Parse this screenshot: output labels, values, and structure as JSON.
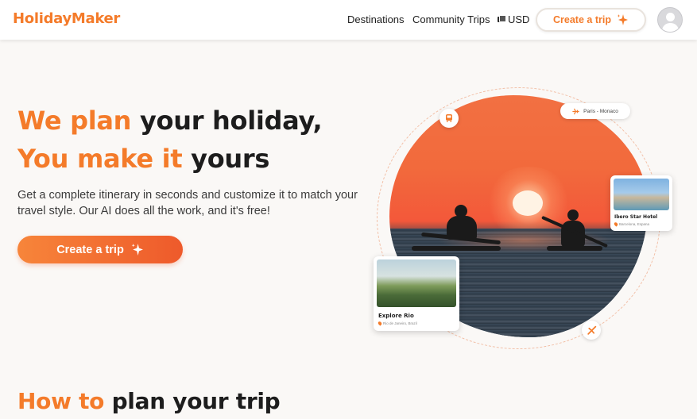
{
  "header": {
    "logo": "HolidayMaker",
    "nav": [
      {
        "label": "Destinations"
      },
      {
        "label": "Community Trips"
      }
    ],
    "currency": "USD",
    "cta_label": "Create a trip"
  },
  "hero": {
    "line1_accent": "We plan",
    "line1_rest": "your holiday,",
    "line2_accent": "You make it",
    "line2_rest": "yours",
    "description": "Get a complete itinerary in seconds and customize it to match your travel style. Our AI does all the work, and it's free!",
    "cta_label": "Create a trip"
  },
  "visual": {
    "route_label": "Paris - Monaco",
    "hotel_card": {
      "title": "Ibero Star Hotel",
      "location": "Barcelona, Espana"
    },
    "rio_card": {
      "title": "Explore Rio",
      "location": "Rio de Janeiro, Brazil"
    }
  },
  "section": {
    "heading_accent": "How to",
    "heading_rest": "plan your trip"
  },
  "colors": {
    "accent": "#f47b2a",
    "cta_gradient_start": "#f7853a",
    "cta_gradient_end": "#ee5a2b"
  },
  "icons": [
    "sparkle-icon",
    "currency-icon",
    "user-avatar-icon",
    "train-icon",
    "plane-icon",
    "location-pin-icon"
  ]
}
